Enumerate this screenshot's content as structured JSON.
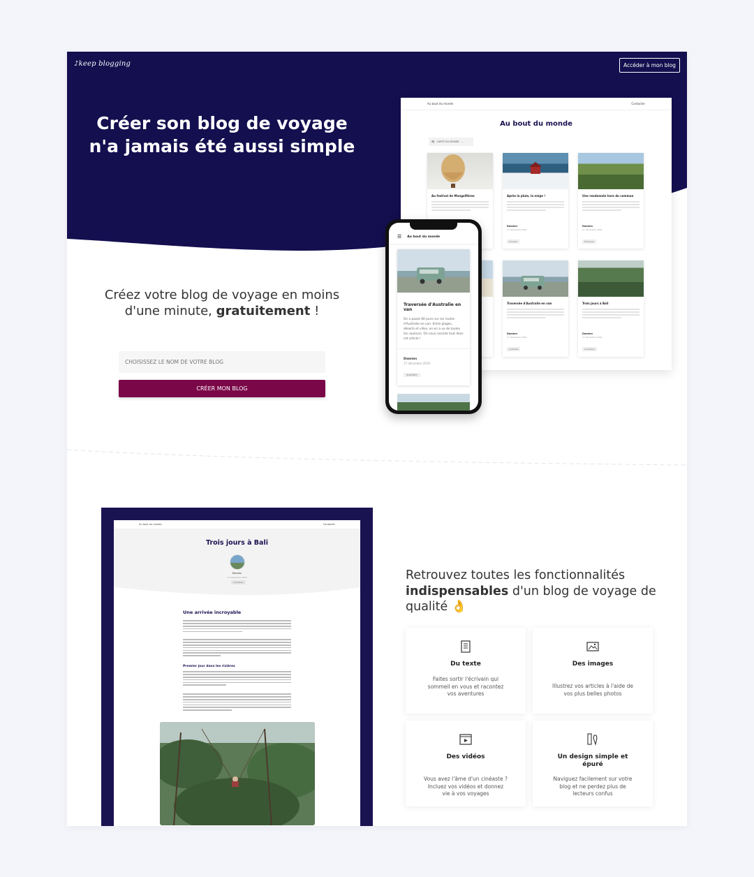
{
  "header": {
    "logo": "keep blogging",
    "access_button": "Accéder à mon blog"
  },
  "hero": {
    "title": "Créer son blog de voyage n'a jamais été aussi simple",
    "subtitle_pre": "Créez votre blog de voyage en moins d'une minute,",
    "subtitle_bold": "gratuitement",
    "subtitle_post": " !",
    "input_placeholder": "CHOISISSEZ LE NOM DE VOTRE BLOG",
    "create_button": "CRÉER MON BLOG"
  },
  "desktop_preview": {
    "nav_left": "Au bout du monde",
    "nav_right": "Contacter",
    "blog_title": "Au bout du monde",
    "map_label": "CARTE DU MONDE",
    "cards": [
      {
        "title": "Au festival de Mongolfières",
        "author": "Damien",
        "date": "17 décembre 2019",
        "tag": "Lituanie"
      },
      {
        "title": "Après la pluie, la neige !",
        "author": "Damien",
        "date": "17 décembre 2019",
        "tag": "Lituanie"
      },
      {
        "title": "Une randonnée hors du commun",
        "author": "Damien",
        "date": "17 décembre 2019",
        "tag": "Mongolie"
      },
      {
        "title": "Traversée d'Australie en van",
        "author": "Damien",
        "date": "17 décembre 2019",
        "tag": "Australie"
      },
      {
        "title": "Trois jours à Bali",
        "author": "Damien",
        "date": "17 décembre 2019",
        "tag": "Indonésie"
      }
    ]
  },
  "phone_preview": {
    "app_title": "Au bout du monde",
    "card_title": "Traversée d'Australie en van",
    "card_text": "On a passé 60 jours sur les routes d'Australie en van. Entre plages, déserts et villes, on en a vu de toutes les couleurs. On vous raconte tout dans cet article !",
    "author": "Damien",
    "date": "17 décembre 2019",
    "tag": "Australie"
  },
  "article_preview": {
    "nav_left": "Au bout du monde",
    "nav_right": "Contacter",
    "title": "Trois jours à Bali",
    "author": "Damien",
    "date": "17 décembre 2019",
    "tag": "Indonésie",
    "heading": "Une arrivée incroyable",
    "subheading": "Premier jour dans les rizières"
  },
  "features": {
    "title_pre": "Retrouvez toutes les fonctionnalités",
    "title_bold": "indispensables",
    "title_post": " d'un blog de voyage de qualité 👌",
    "cards": [
      {
        "icon": "document-icon",
        "title": "Du texte",
        "desc": "Faites sortir l'écrivain qui sommeil en vous et racontez vos aventures"
      },
      {
        "icon": "image-icon",
        "title": "Des images",
        "desc": "Illustrez vos articles à l'aide de vos plus belles photos"
      },
      {
        "icon": "video-icon",
        "title": "Des vidéos",
        "desc": "Vous avez l'âme d'un cinéaste ? Incluez vos vidéos et donnez vie à vos voyages"
      },
      {
        "icon": "design-tools-icon",
        "title": "Un design simple et épuré",
        "desc": "Naviguez facilement sur votre blog et ne perdez plus de lecteurs confus"
      }
    ]
  },
  "colors": {
    "navy": "#140f4f",
    "cta": "#7a0748",
    "background": "#f3f5fa"
  }
}
